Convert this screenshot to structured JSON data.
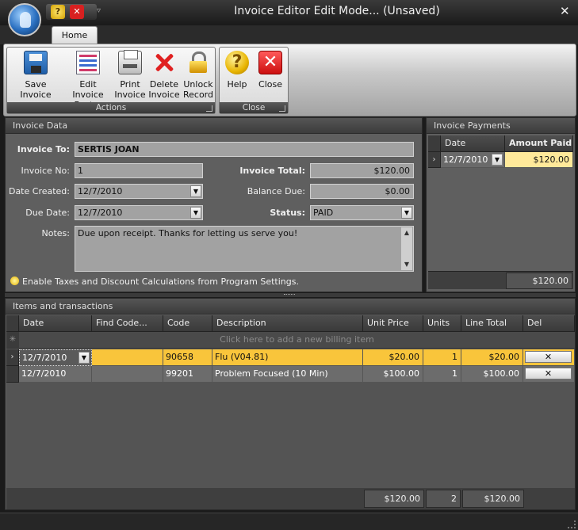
{
  "window": {
    "title": "Invoice Editor Edit Mode... (Unsaved)",
    "close_glyph": "✕",
    "qat_help": "?",
    "qat_close": "✕",
    "qat_menu": "▿"
  },
  "ribbon": {
    "tab": "Home",
    "groups": [
      {
        "label": "Actions",
        "buttons": [
          {
            "line1": "Save Invoice",
            "line2": "",
            "icon": "save-icon"
          },
          {
            "line1": "Edit Invoice",
            "line2": "Footer",
            "icon": "invoice-footer-icon"
          },
          {
            "line1": "Print",
            "line2": "Invoice",
            "icon": "printer-icon"
          },
          {
            "line1": "Delete",
            "line2": "Invoice",
            "icon": "delete-x-icon"
          },
          {
            "line1": "Unlock",
            "line2": "Record",
            "icon": "lock-icon"
          }
        ]
      },
      {
        "label": "Close",
        "buttons": [
          {
            "line1": "Help",
            "line2": "",
            "icon": "help-icon",
            "glyph": "?"
          },
          {
            "line1": "Close",
            "line2": "",
            "icon": "close-icon",
            "glyph": "✕"
          }
        ]
      }
    ]
  },
  "invoice": {
    "header": "Invoice Data",
    "invoice_to_label": "Invoice To:",
    "invoice_to": "SERTIS JOAN",
    "invoice_no_label": "Invoice No:",
    "invoice_no": "1",
    "invoice_total_label": "Invoice Total:",
    "invoice_total": "$120.00",
    "date_created_label": "Date Created:",
    "date_created": "12/7/2010",
    "balance_due_label": "Balance Due:",
    "balance_due": "$0.00",
    "due_date_label": "Due Date:",
    "due_date": "12/7/2010",
    "status_label": "Status:",
    "status": "PAID",
    "notes_label": "Notes:",
    "notes": "Due upon receipt. Thanks for letting us serve you!",
    "tip": "Enable Taxes and Discount Calculations from Program Settings.",
    "dropdown_glyph": "▼",
    "scroll_up": "▲",
    "scroll_down": "▼"
  },
  "payments": {
    "header": "Invoice Payments",
    "columns": [
      "Date",
      "Amount Paid"
    ],
    "rows": [
      {
        "date": "12/7/2010",
        "amount": "$120.00"
      }
    ],
    "total": "$120.00",
    "row_indicator": "›"
  },
  "items": {
    "header": "Items and transactions",
    "columns": [
      "Date",
      "Find Code...",
      "Code",
      "Description",
      "Unit Price",
      "Units",
      "Line Total",
      "Del"
    ],
    "new_row": "Click here to add a new billing item",
    "new_row_marker": "✳",
    "rows": [
      {
        "date": "12/7/2010",
        "find": "",
        "code": "90658",
        "description": "Flu (V04.81)",
        "unit_price": "$20.00",
        "units": "1",
        "line_total": "$20.00",
        "del": "✕"
      },
      {
        "date": "12/7/2010",
        "find": "",
        "code": "99201",
        "description": "Problem Focused (10 Min)",
        "unit_price": "$100.00",
        "units": "1",
        "line_total": "$100.00",
        "del": "✕"
      }
    ],
    "totals": {
      "unit_price": "$120.00",
      "units": "2",
      "line_total": "$120.00"
    }
  },
  "colors": {
    "selected_row": "#f9c53b",
    "dark_row": "#6c6c6c",
    "amount_highlight": "#ffe99a"
  }
}
